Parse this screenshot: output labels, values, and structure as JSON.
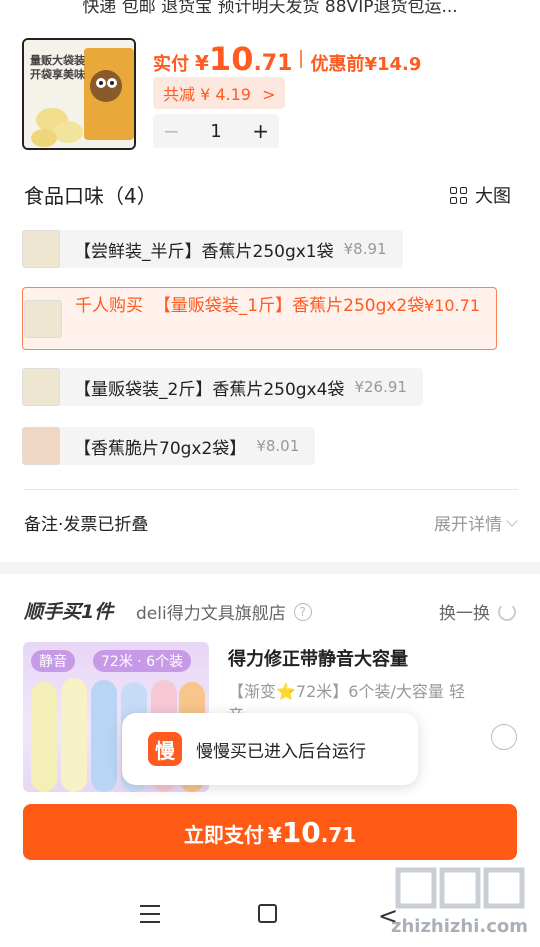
{
  "header": {
    "top_text": "快递 包邮 退货宝 预计明天发货 88VIP退货包运..."
  },
  "product": {
    "image_caption": "量贩大袋装 开袋享美味",
    "paid_label": "实付",
    "currency": "¥",
    "paid_int": "10",
    "paid_dec": ".71",
    "before_label": "优惠前",
    "before_price": "¥14.9",
    "saved_text": "共减 ¥ 4.19",
    "saved_arrow": ">",
    "qty_minus": "−",
    "qty": "1",
    "qty_plus": "+"
  },
  "flavors": {
    "title": "食品口味（4）",
    "big_view": "大图",
    "options": [
      {
        "name": "【尝鲜装_半斤】香蕉片250gx1袋",
        "price": "¥8.91"
      },
      {
        "prefix": "千人购买",
        "name": "【量贩袋装_1斤】香蕉片250gx2袋",
        "price": "¥10.71"
      },
      {
        "name": "【量贩袋装_2斤】香蕉片250gx4袋",
        "price": "¥26.91"
      },
      {
        "name": "【香蕉脆片70gx2袋】",
        "price": "¥8.01"
      }
    ]
  },
  "remarks": {
    "label": "备注·发票已折叠",
    "expand": "展开详情"
  },
  "addon": {
    "title": "顺手买1件",
    "shop": "deli得力文具旗舰店",
    "help": "?",
    "swap": "换一换",
    "tag1": "静音",
    "tag2": "72米 · 6个装",
    "name": "得力修正带静音大容量",
    "spec": "【渐变⭐72米】6个装/大容量 轻音"
  },
  "toast": {
    "app_glyph": "慢",
    "message": "慢慢买已进入后台运行"
  },
  "pay_button": {
    "label": "立即支付",
    "currency": "¥",
    "int": "10",
    "dec": ".71"
  },
  "watermark": {
    "text": "zhizhizhi.com"
  },
  "colors": {
    "accent": "#ff5a16",
    "muted": "#999999"
  }
}
